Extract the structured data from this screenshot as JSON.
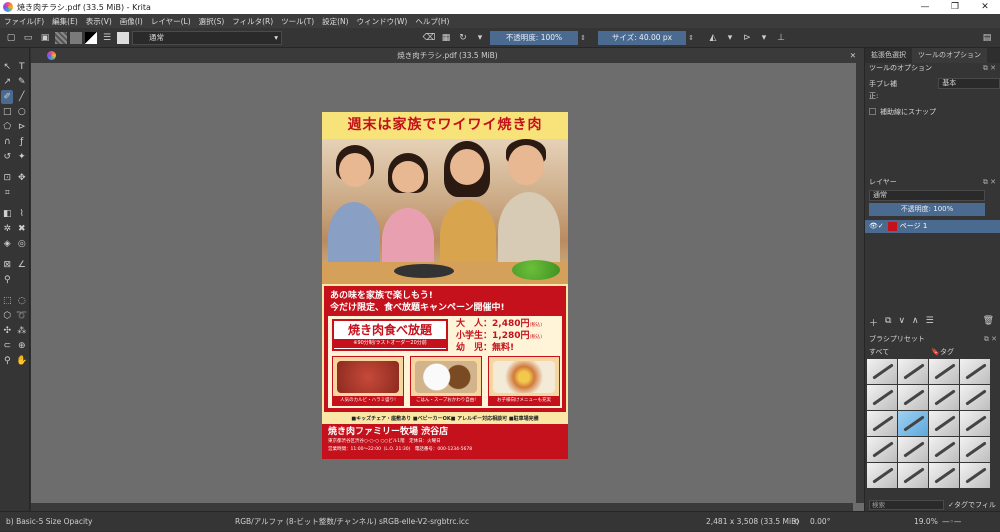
{
  "window": {
    "title": "焼き肉チラシ.pdf (33.5 MiB) - Krita",
    "controls": [
      "—",
      "❐",
      "✕"
    ]
  },
  "menu": [
    "ファイル(F)",
    "編集(E)",
    "表示(V)",
    "画像(I)",
    "レイヤー(L)",
    "選択(S)",
    "フィルタ(R)",
    "ツール(T)",
    "設定(N)",
    "ウィンドウ(W)",
    "ヘルプ(H)"
  ],
  "toolbar": {
    "blend_mode": "通常",
    "opacity": "不透明度: 100%",
    "size": "サイズ: 40.00 px"
  },
  "document": {
    "tab_title": "焼き肉チラシ.pdf (33.5 MiB)"
  },
  "flyer": {
    "headline": "週末は家族でワイワイ焼き肉",
    "line1": "あの味を家族で楽しもう!",
    "line2": "今だけ限定、食べ放題キャンペーン開催中!",
    "plan_title": "焼き肉食べ放題",
    "plan_note": "※90分制/ラストオーダー20分前",
    "prices": [
      {
        "label": "大　人：",
        "value": "2,480円",
        "tax": "(税込)"
      },
      {
        "label": "小学生：",
        "value": "1,280円",
        "tax": "(税込)"
      },
      {
        "label": "幼　児：",
        "value": "無料!",
        "tax": ""
      }
    ],
    "dishes": [
      "人気のカルビ・ハラミ盛り!",
      "ごはん・スープおかわり自由!",
      "お子様向けメニューも充実"
    ],
    "features": "■キッズチェア・座敷あり ■ベビーカーOK■ アレルギー対応相談可 ■駐車場完備",
    "shop": "焼き肉ファミリー牧場 渋谷店",
    "address": "東京都渋谷区渋谷○-○-○ ○○ビル1階　定休日：火曜日",
    "hours": "営業時間：11:00～22:00（L.O. 21:30)　電話番号：000-1234-5678"
  },
  "right_panel": {
    "tabs": [
      "拡張色選択",
      "ツールのオプション"
    ],
    "tool_options_header": "ツールのオプション",
    "stabilizer_label": "手ブレ補正:",
    "stabilizer_value": "基本",
    "snap_label": "補助線にスナップ",
    "layers_header": "レイヤー",
    "layer_blend": "通常",
    "layer_opacity": "不透明度: 100%",
    "layer_name": "ページ 1",
    "brush_presets_header": "ブラシプリセット",
    "brush_filter": "すべて",
    "tag_label": "タグ",
    "search_placeholder": "検索",
    "tag_filter_label": "タグでフィルタ"
  },
  "status": {
    "brush": "b) Basic-5 Size Opacity",
    "color_info": "RGB/アルファ (8-ビット整数/チャンネル)  sRGB-elle-V2-srgbtrc.icc",
    "dimensions": "2,481 x 3,508 (33.5 MiB)",
    "rotation": "0.00°",
    "zoom": "19.0%"
  }
}
